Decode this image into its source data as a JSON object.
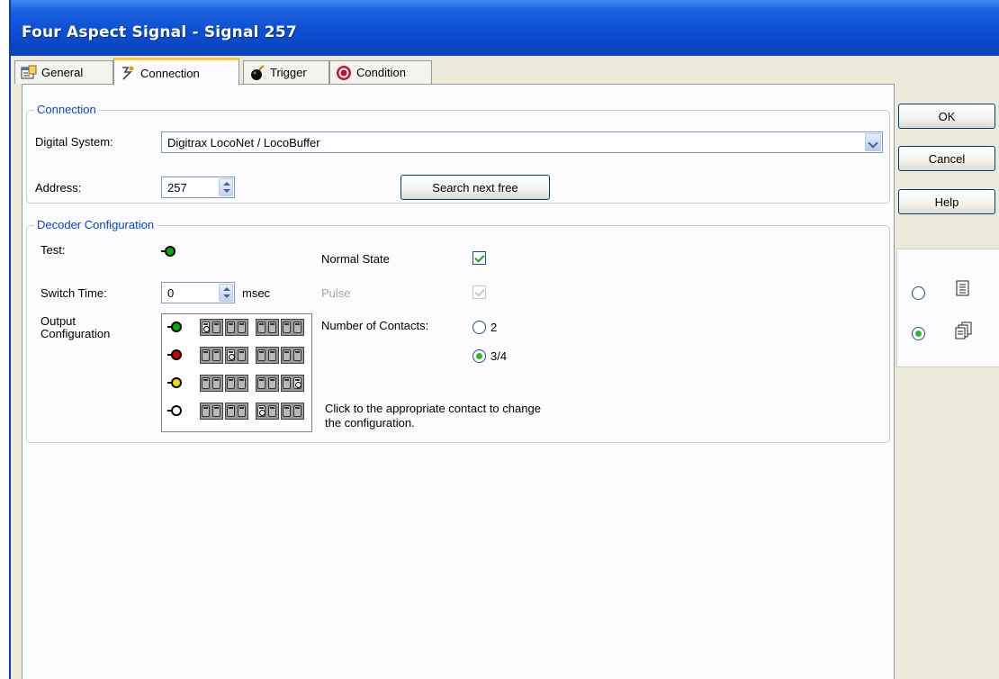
{
  "window": {
    "title": "Four Aspect Signal - Signal 257"
  },
  "tabs": [
    {
      "label": "General",
      "icon": "properties-icon",
      "active": false
    },
    {
      "label": "Connection",
      "icon": "connection-icon",
      "active": true
    },
    {
      "label": "Trigger",
      "icon": "bomb-icon",
      "active": false
    },
    {
      "label": "Condition",
      "icon": "stop-icon",
      "active": false
    }
  ],
  "connection": {
    "legend": "Connection",
    "digital_system_label": "Digital System:",
    "digital_system_value": "Digitrax LocoNet / LocoBuffer",
    "address_label": "Address:",
    "address_value": "257",
    "search_button": "Search next free"
  },
  "decoder": {
    "legend": "Decoder Configuration",
    "test_label": "Test:",
    "test_led_color": "#00b000",
    "normal_state_label": "Normal State",
    "normal_state_checked": true,
    "switch_time_label": "Switch Time:",
    "switch_time_value": "0",
    "switch_time_unit": "msec",
    "pulse_label": "Pulse",
    "pulse_checked": true,
    "output_label": "Output Configuration",
    "aspects": [
      {
        "color": "#00b000",
        "marks": [
          "1",
          "",
          "",
          ""
        ]
      },
      {
        "color": "#d00000",
        "marks": [
          "",
          "2",
          "",
          ""
        ]
      },
      {
        "color": "#f0e000",
        "marks": [
          "",
          "",
          "",
          "3"
        ]
      },
      {
        "color": "#ffffff",
        "marks": [
          "",
          "",
          "4",
          ""
        ]
      }
    ],
    "contacts_label": "Number of Contacts:",
    "contacts_options": [
      "2",
      "3/4"
    ],
    "contacts_selected": "3/4",
    "hint": "Click to the appropriate contact to change the configuration."
  },
  "buttons": {
    "ok": "OK",
    "cancel": "Cancel",
    "help": "Help"
  },
  "side_panel": {
    "selected_view": "detail"
  }
}
